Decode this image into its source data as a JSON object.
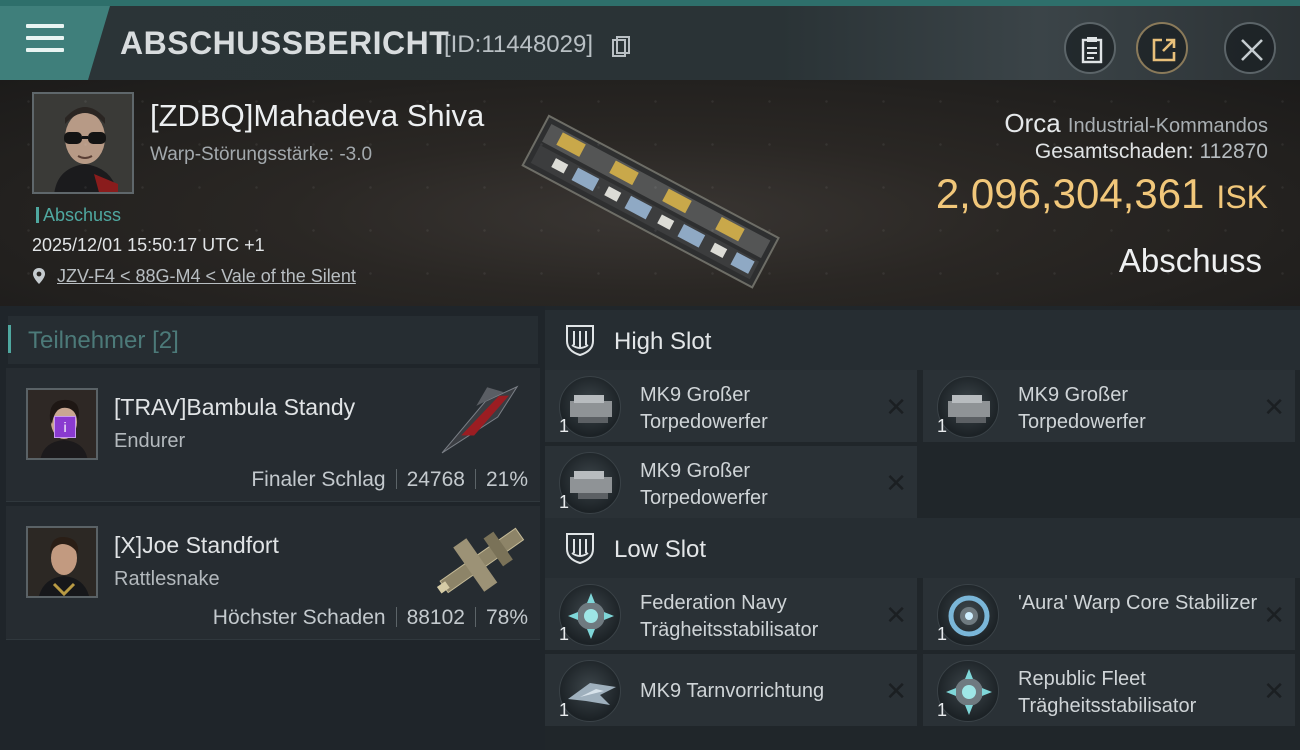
{
  "header": {
    "title": "ABSCHUSSBERICHT",
    "id_label": "[ID:11448029]",
    "icons": [
      "menu-icon",
      "copy-icon",
      "clipboard-icon",
      "share-icon",
      "close-icon"
    ]
  },
  "victim": {
    "name": "[ZDBQ]Mahadeva Shiva",
    "warp_strength": "Warp-Störungsstärke: -3.0",
    "tag": "Abschuss",
    "datetime": "2025/12/01 15:50:17 UTC +1",
    "location": "JZV-F4 < 88G-M4 < Vale of the Silent",
    "ship": "Orca",
    "ship_class": "Industrial-Kommandos",
    "total_damage_label": "Gesamtschaden:",
    "total_damage": "112870",
    "isk_value": "2,096,304,361",
    "isk_unit": "ISK",
    "result": "Abschuss"
  },
  "participants": {
    "title": "Teilnehmer",
    "count": "[2]",
    "rows": [
      {
        "name": "[TRAV]Bambula Standy",
        "ship": "Endurer",
        "role": "Finaler Schlag",
        "damage": "24768",
        "percent": "21%",
        "badge": "i"
      },
      {
        "name": "[X]Joe Standfort",
        "ship": "Rattlesnake",
        "role": "Höchster Schaden",
        "damage": "88102",
        "percent": "78%"
      }
    ]
  },
  "slots": {
    "high": {
      "title": "High Slot",
      "items": [
        {
          "name": "MK9 Großer Torpedowerfer",
          "qty": "1"
        },
        {
          "name": "MK9 Großer Torpedowerfer",
          "qty": "1"
        },
        {
          "name": "MK9 Großer Torpedowerfer",
          "qty": "1"
        }
      ]
    },
    "low": {
      "title": "Low Slot",
      "items": [
        {
          "name": "Federation Navy Trägheitsstabilisator",
          "qty": "1"
        },
        {
          "name": "'Aura' Warp Core Stabilizer",
          "qty": "1"
        },
        {
          "name": "MK9 Tarnvorrichtung",
          "qty": "1"
        },
        {
          "name": "Republic Fleet Trägheitsstabilisator",
          "qty": "1"
        }
      ]
    },
    "remove_glyph": "✕"
  }
}
